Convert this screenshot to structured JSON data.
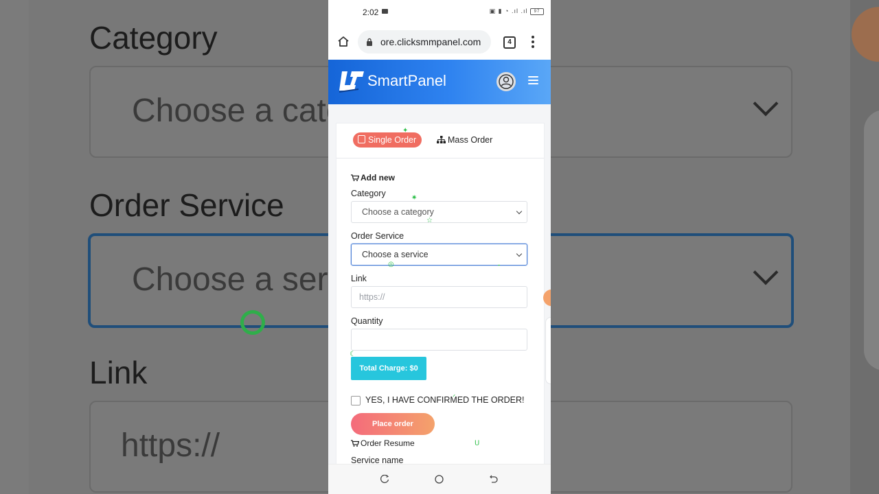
{
  "backdrop": {
    "labels": [
      "Category",
      "Order Service",
      "Link"
    ],
    "category_text": "Choose a cate",
    "service_text": "Choose a serv",
    "link_text": "https://"
  },
  "status_bar": {
    "time": "2:02",
    "icons": "▣ ▮ ◔ .ıl .ıl",
    "battery": "97"
  },
  "browser": {
    "url": "ore.clicksmmpanel.com",
    "tab_count": "4"
  },
  "header": {
    "brand": "SmartPanel"
  },
  "tabs": {
    "single": "Single Order",
    "mass": "Mass Order"
  },
  "form": {
    "section_title": "Add new",
    "category_label": "Category",
    "category_placeholder": "Choose a category",
    "service_label": "Order Service",
    "service_placeholder": "Choose a service",
    "link_label": "Link",
    "link_placeholder": "https://",
    "quantity_label": "Quantity",
    "quantity_value": "",
    "total_charge": "Total Charge: $0",
    "confirm_text": "YES, I HAVE CONFIRMED THE ORDER!",
    "place_order": "Place order",
    "resume_title": "Order Resume",
    "service_name_label": "Service name"
  },
  "colors": {
    "brand_gradient_start": "#1565d8",
    "brand_gradient_end": "#5aa7f7",
    "single_tab": "#f06d61",
    "charge_button": "#27c6dd",
    "place_gradient_start": "#f46b7b",
    "place_gradient_end": "#f4a26b"
  }
}
